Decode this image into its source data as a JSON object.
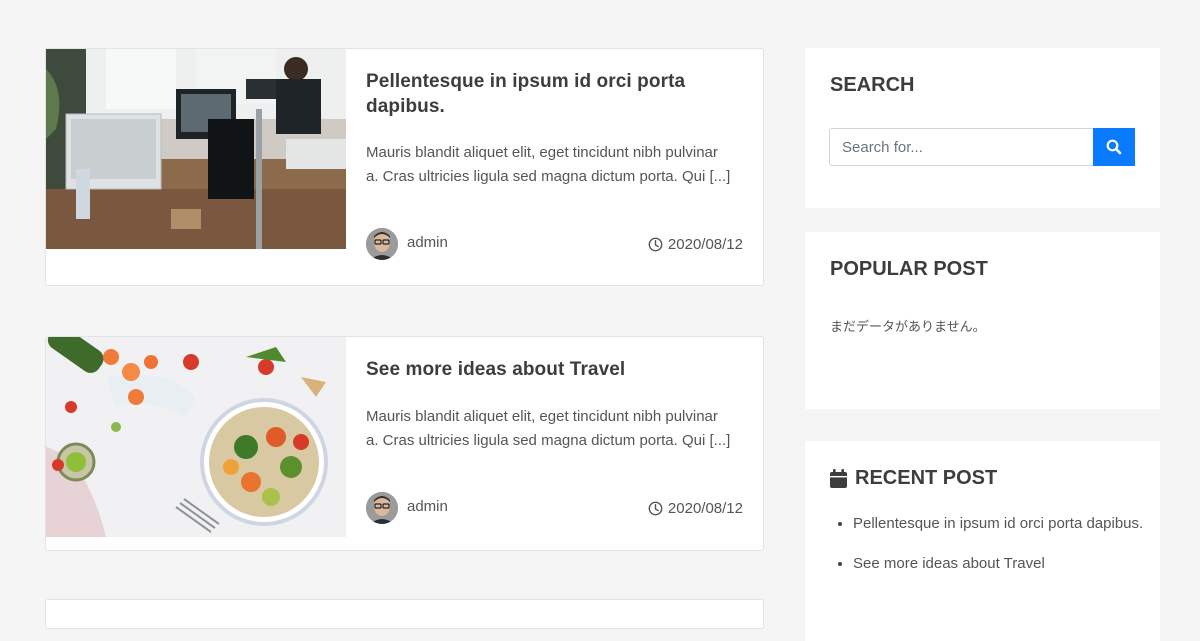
{
  "posts": [
    {
      "title": "Pellentesque in ipsum id orci porta dapibus.",
      "excerpt": "Mauris blandit aliquet elit, eget tincidunt nibh pulvinar a. Cras ultricies ligula sed magna dictum porta. Qui [...]",
      "author": "admin",
      "date": "2020/08/12",
      "thumbnail": "office-desk-photo"
    },
    {
      "title": "See more ideas about Travel",
      "excerpt": "Mauris blandit aliquet elit, eget tincidunt nibh pulvinar a. Cras ultricies ligula sed magna dictum porta. Qui [...]",
      "author": "admin",
      "date": "2020/08/12",
      "thumbnail": "salad-bowl-photo"
    }
  ],
  "sidebar": {
    "search": {
      "title": "SEARCH",
      "placeholder": "Search for...",
      "button_icon": "search-icon"
    },
    "popular": {
      "title": "POPULAR POST",
      "empty_text": "まだデータがありません。"
    },
    "recent": {
      "title": "RECENT POST",
      "icon": "calendar-icon",
      "items": [
        "Pellentesque in ipsum id orci porta dapibus.",
        "See more ideas about Travel"
      ]
    }
  },
  "colors": {
    "page_bg": "#f5f5f5",
    "accent": "#0a7bff",
    "heading": "#3d3d3d",
    "text": "#555555"
  }
}
